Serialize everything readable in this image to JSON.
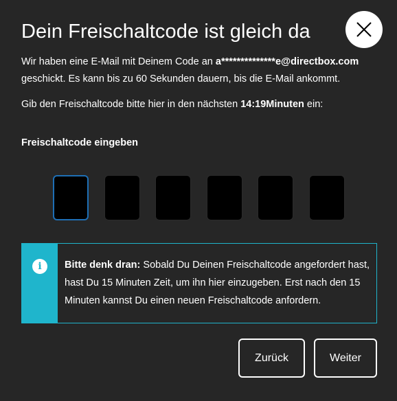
{
  "dialog": {
    "title": "Dein Freischaltcode ist gleich da",
    "close_icon": "close-icon",
    "message": {
      "line1_prefix": "Wir haben eine E-Mail mit Deinem Code an ",
      "email": "a**************e@directbox.com",
      "line1_suffix": " geschickt. Es kann bis zu 60 Sekunden dauern, bis die E-Mail ankommt.",
      "line2_prefix": "Gib den Freischaltcode bitte hier in den nächsten ",
      "countdown": "14:19Minuten",
      "line2_suffix": " ein:"
    },
    "code_label": "Freischaltcode eingeben",
    "code_digits": [
      "",
      "",
      "",
      "",
      "",
      ""
    ],
    "info": {
      "icon": "info-icon",
      "icon_glyph": "i",
      "bold": "Bitte denk dran:",
      "text": " Sobald Du Deinen Freischaltcode angefordert hast, hast Du 15 Minuten Zeit, um ihn hier einzugeben. Erst nach den 15 Minuten kannst Du einen neuen Freischaltcode anfordern."
    },
    "buttons": {
      "back": "Zurück",
      "next": "Weiter"
    },
    "colors": {
      "background": "#262626",
      "accent": "#1fb5cc",
      "focus": "#1e6fb5"
    }
  }
}
